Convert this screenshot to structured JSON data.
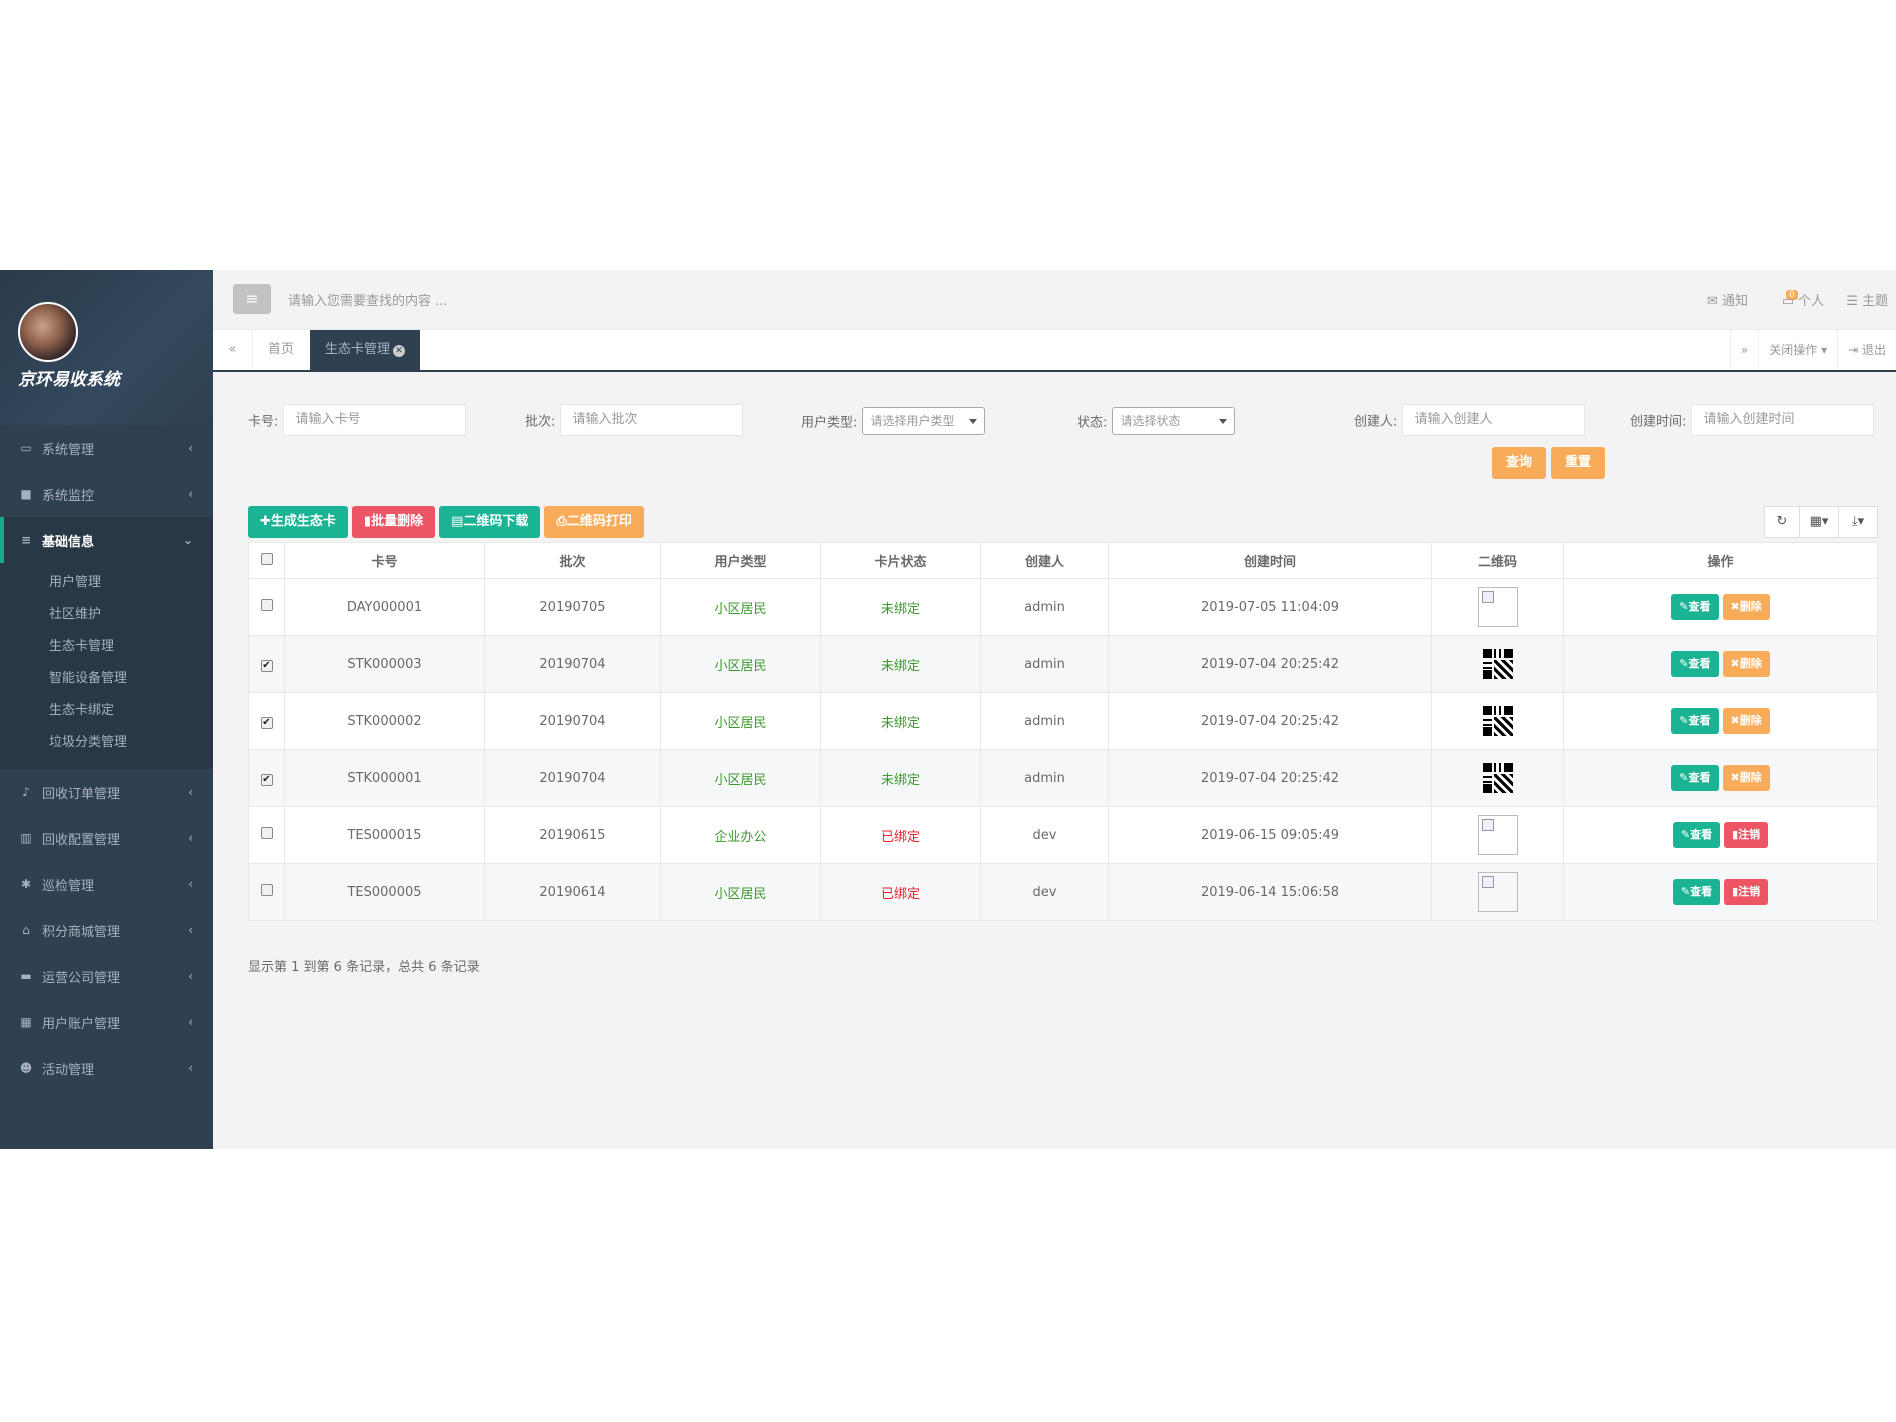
{
  "sidebar": {
    "title": "京环易收系统",
    "items": [
      {
        "label": "系统管理",
        "icon": "monitor-icon",
        "glyph": "▭"
      },
      {
        "label": "系统监控",
        "icon": "video-icon",
        "glyph": "■"
      },
      {
        "label": "基础信息",
        "icon": "list-icon",
        "glyph": "≡"
      },
      {
        "label": "回收订单管理",
        "icon": "bell-icon",
        "glyph": "♪"
      },
      {
        "label": "回收配置管理",
        "icon": "bar-chart-icon",
        "glyph": "▥"
      },
      {
        "label": "巡检管理",
        "icon": "bug-icon",
        "glyph": "✱"
      },
      {
        "label": "积分商城管理",
        "icon": "bank-icon",
        "glyph": "⌂"
      },
      {
        "label": "运营公司管理",
        "icon": "archive-icon",
        "glyph": "▬"
      },
      {
        "label": "用户账户管理",
        "icon": "calculator-icon",
        "glyph": "▦"
      },
      {
        "label": "活动管理",
        "icon": "users-icon",
        "glyph": "☻"
      }
    ],
    "subitems": [
      "用户管理",
      "社区维护",
      "生态卡管理",
      "智能设备管理",
      "生态卡绑定",
      "垃圾分类管理"
    ]
  },
  "topbar": {
    "search_placeholder": "请输入您需要查找的内容 ...",
    "notify": "通知",
    "notify_count": "0",
    "personal": "个人",
    "theme": "主题"
  },
  "tabs": {
    "home": "首页",
    "active": "生态卡管理",
    "close_ops": "关闭操作",
    "logout": "退出"
  },
  "filters": {
    "card_no_label": "卡号:",
    "card_no_placeholder": "请输入卡号",
    "batch_label": "批次:",
    "batch_placeholder": "请输入批次",
    "user_type_label": "用户类型:",
    "user_type_placeholder": "请选择用户类型",
    "status_label": "状态:",
    "status_placeholder": "请选择状态",
    "creator_label": "创建人:",
    "creator_placeholder": "请输入创建人",
    "create_time_label": "创建时间:",
    "create_time_placeholder": "请输入创建时间",
    "query": "查询",
    "reset": "重置"
  },
  "toolbar": {
    "generate": "生成生态卡",
    "batch_delete": "批量删除",
    "qr_download": "二维码下载",
    "qr_print": "二维码打印"
  },
  "table": {
    "headers": [
      "卡号",
      "批次",
      "用户类型",
      "卡片状态",
      "创建人",
      "创建时间",
      "二维码",
      "操作"
    ],
    "rows": [
      {
        "checked": false,
        "card": "DAY000001",
        "batch": "20190705",
        "type": "小区居民",
        "status": "未绑定",
        "status_kind": "green",
        "creator": "admin",
        "time": "2019-07-05 11:04:09",
        "qr": "broken",
        "view": "查看",
        "action": "删除",
        "action_kind": "orange"
      },
      {
        "checked": true,
        "card": "STK000003",
        "batch": "20190704",
        "type": "小区居民",
        "status": "未绑定",
        "status_kind": "green",
        "creator": "admin",
        "time": "2019-07-04 20:25:42",
        "qr": "real",
        "view": "查看",
        "action": "删除",
        "action_kind": "orange"
      },
      {
        "checked": true,
        "card": "STK000002",
        "batch": "20190704",
        "type": "小区居民",
        "status": "未绑定",
        "status_kind": "green",
        "creator": "admin",
        "time": "2019-07-04 20:25:42",
        "qr": "real",
        "view": "查看",
        "action": "删除",
        "action_kind": "orange"
      },
      {
        "checked": true,
        "card": "STK000001",
        "batch": "20190704",
        "type": "小区居民",
        "status": "未绑定",
        "status_kind": "green",
        "creator": "admin",
        "time": "2019-07-04 20:25:42",
        "qr": "real",
        "view": "查看",
        "action": "删除",
        "action_kind": "orange"
      },
      {
        "checked": false,
        "card": "TES000015",
        "batch": "20190615",
        "type": "企业办公",
        "status": "已绑定",
        "status_kind": "red",
        "creator": "dev",
        "time": "2019-06-15 09:05:49",
        "qr": "broken",
        "view": "查看",
        "action": "注销",
        "action_kind": "red"
      },
      {
        "checked": false,
        "card": "TES000005",
        "batch": "20190614",
        "type": "小区居民",
        "status": "已绑定",
        "status_kind": "red",
        "creator": "dev",
        "time": "2019-06-14 15:06:58",
        "qr": "broken",
        "view": "查看",
        "action": "注销",
        "action_kind": "red"
      }
    ]
  },
  "pagination_info": "显示第 1 到第 6 条记录，总共 6 条记录",
  "colors": {
    "sidebar": "#2f4050",
    "green": "#1ab394",
    "orange": "#f8ac59",
    "red": "#ed5565"
  }
}
